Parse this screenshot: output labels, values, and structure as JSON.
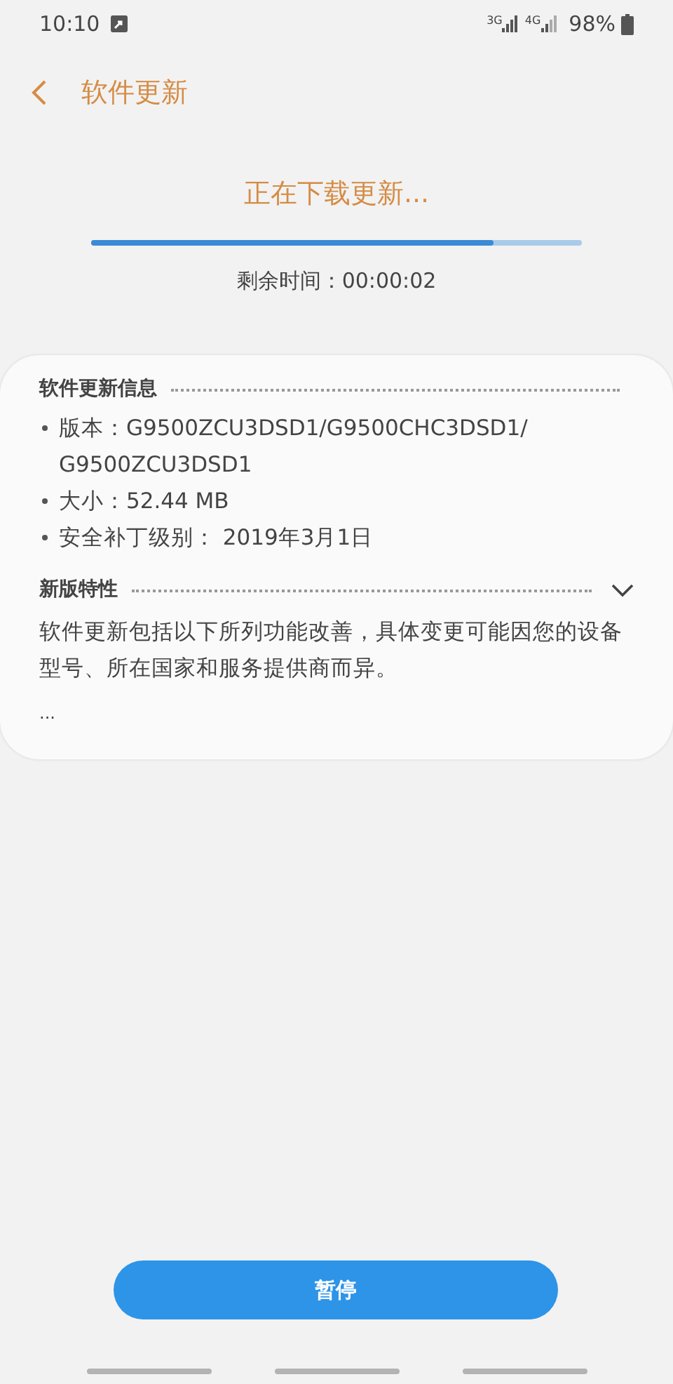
{
  "status_bar": {
    "time": "10:10",
    "network_1": "3G",
    "network_2": "4G",
    "battery": "98%"
  },
  "header": {
    "title": "软件更新"
  },
  "download": {
    "heading": "正在下载更新...",
    "level": 0.82,
    "remaining": "剩余时间：00:00:02"
  },
  "info": {
    "title": "软件更新信息",
    "items": [
      "版本：G9500ZCU3DSD1/G9500CHC3DSD1/ G9500ZCU3DSD1",
      "大小：52.44 MB",
      "安全补丁级别： 2019年3月1日"
    ]
  },
  "features": {
    "title": "新版特性",
    "expanded": false,
    "text": "软件更新包括以下所列功能改善，具体变更可能因您的设备型号、所在国家和服务提供商而异。",
    "more": "..."
  },
  "buttons": [
    {
      "label": "暂停"
    }
  ]
}
